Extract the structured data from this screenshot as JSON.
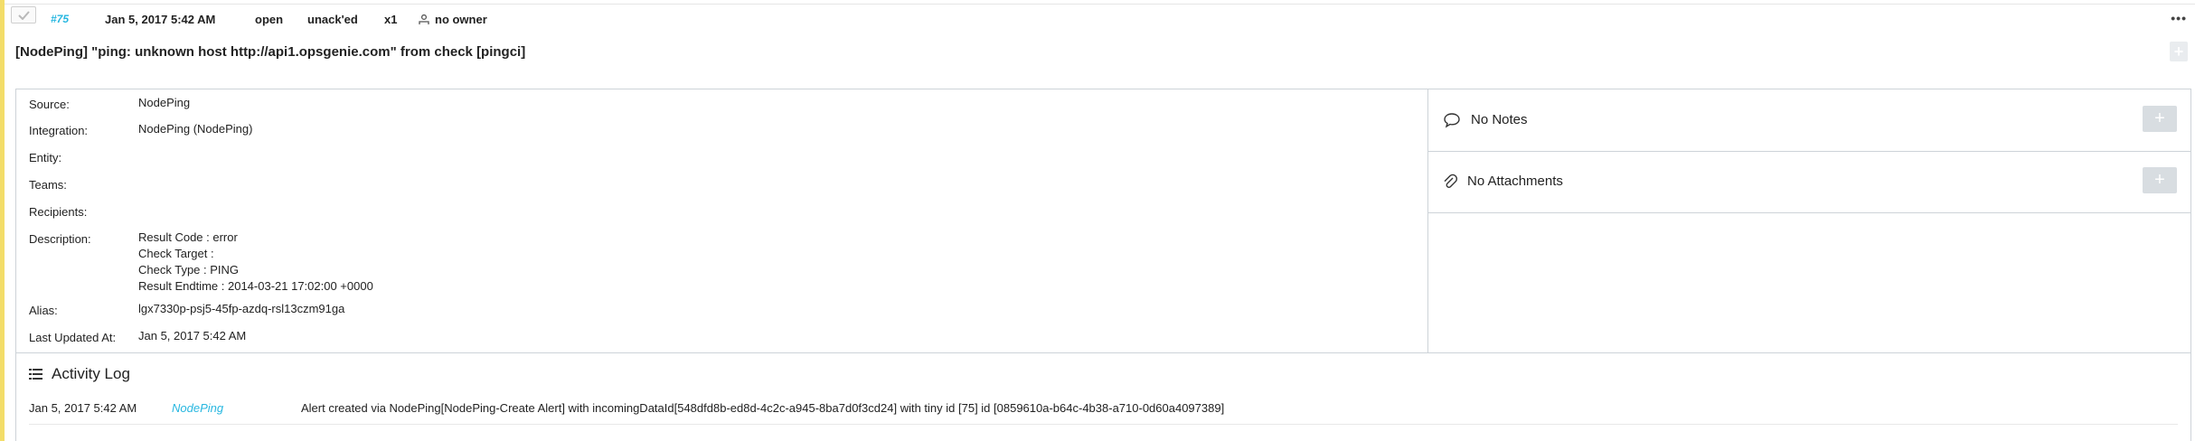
{
  "header": {
    "id": "#75",
    "date": "Jan 5, 2017 5:42 AM",
    "status": "open",
    "ack": "unack'ed",
    "count": "x1",
    "owner": "no owner",
    "more": "•••"
  },
  "alert": {
    "title": "[NodePing] \"ping: unknown host http://api1.opsgenie.com\" from check [pingci]"
  },
  "details": {
    "source_label": "Source:",
    "source": "NodePing",
    "integration_label": "Integration:",
    "integration": "NodePing (NodePing)",
    "entity_label": "Entity:",
    "teams_label": "Teams:",
    "recipients_label": "Recipients:",
    "description_label": "Description:",
    "description_lines": [
      "Result Code : error",
      "Check Target :",
      "Check Type : PING",
      "Result Endtime : 2014-03-21 17:02:00 +0000"
    ],
    "alias_label": "Alias:",
    "alias": "lgx7330p-psj5-45fp-azdq-rsl13czm91ga",
    "last_updated_label": "Last Updated At:",
    "last_updated": "Jan 5, 2017 5:42 AM"
  },
  "side": {
    "notes": "No Notes",
    "attachments": "No Attachments",
    "add": "+"
  },
  "activity": {
    "title": "Activity Log",
    "entries": [
      {
        "date": "Jan 5, 2017 5:42 AM",
        "source": "NodePing",
        "message": "Alert created via NodePing[NodePing-Create Alert] with incomingDataId[548dfd8b-ed8d-4c2c-a945-8ba7d0f3cd24] with tiny id [75] id [0859610a-b64c-4b38-a710-0d60a4097389]"
      }
    ]
  },
  "colors": {
    "accent": "#f3dd69",
    "link": "#27b7e0",
    "border": "#cdd3d8",
    "button": "#d8dde1"
  }
}
